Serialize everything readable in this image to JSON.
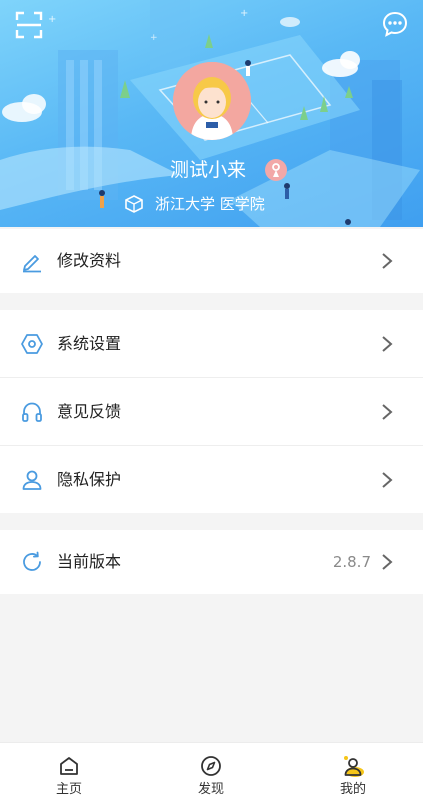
{
  "profile": {
    "name": "测试小来",
    "school": "浙江大学 医学院"
  },
  "menu": {
    "edit_profile": "修改资料",
    "system_settings": "系统设置",
    "feedback": "意见反馈",
    "privacy": "隐私保护",
    "current_version": "当前版本",
    "version_value": "2.8.7"
  },
  "tabbar": {
    "home": "主页",
    "discover": "发现",
    "mine": "我的"
  },
  "icons": {
    "scan": "scan-icon",
    "chat": "chat-bubble-icon",
    "gender": "female-icon",
    "school": "school-cube-icon",
    "edit": "pencil-icon",
    "settings": "hexagon-settings-icon",
    "feedback": "headphones-icon",
    "privacy": "user-icon",
    "version": "refresh-icon",
    "chevron": "chevron-right-icon"
  },
  "colors": {
    "accent": "#4a9be0",
    "header_top": "#7fd4fb",
    "header_bottom": "#3f9ff0",
    "active_tab_dot": "#f5c518",
    "avatar_bg": "#f3a7a0"
  }
}
